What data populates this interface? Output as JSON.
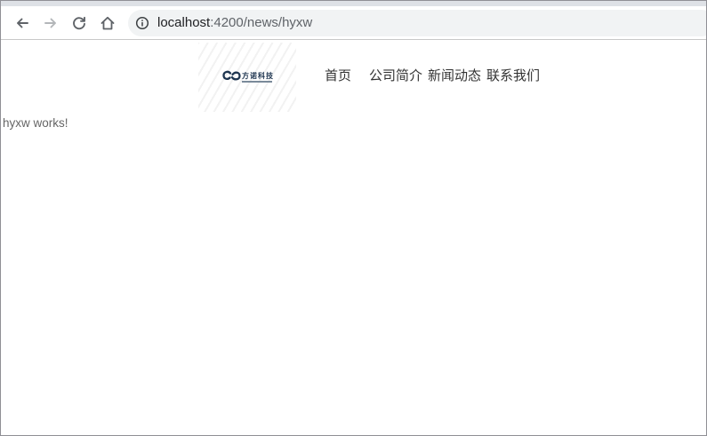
{
  "browser": {
    "url_host": "localhost",
    "url_rest": ":4200/news/hyxw"
  },
  "header": {
    "logo_text": "方诺科技",
    "nav": {
      "home": "首页",
      "about": "公司简介",
      "news": "新闻动态",
      "contact": "联系我们"
    }
  },
  "main": {
    "text": "hyxw works!"
  },
  "colors": {
    "nav_text": "#333333",
    "content_text": "#666666",
    "omnibox_bg": "#f1f3f4",
    "logo_color": "#1e3550"
  },
  "icons": {
    "back": "arrow-left-icon",
    "forward": "arrow-right-icon",
    "reload": "reload-icon",
    "home": "home-icon",
    "info": "info-icon",
    "logo": "logo-mark-icon"
  }
}
